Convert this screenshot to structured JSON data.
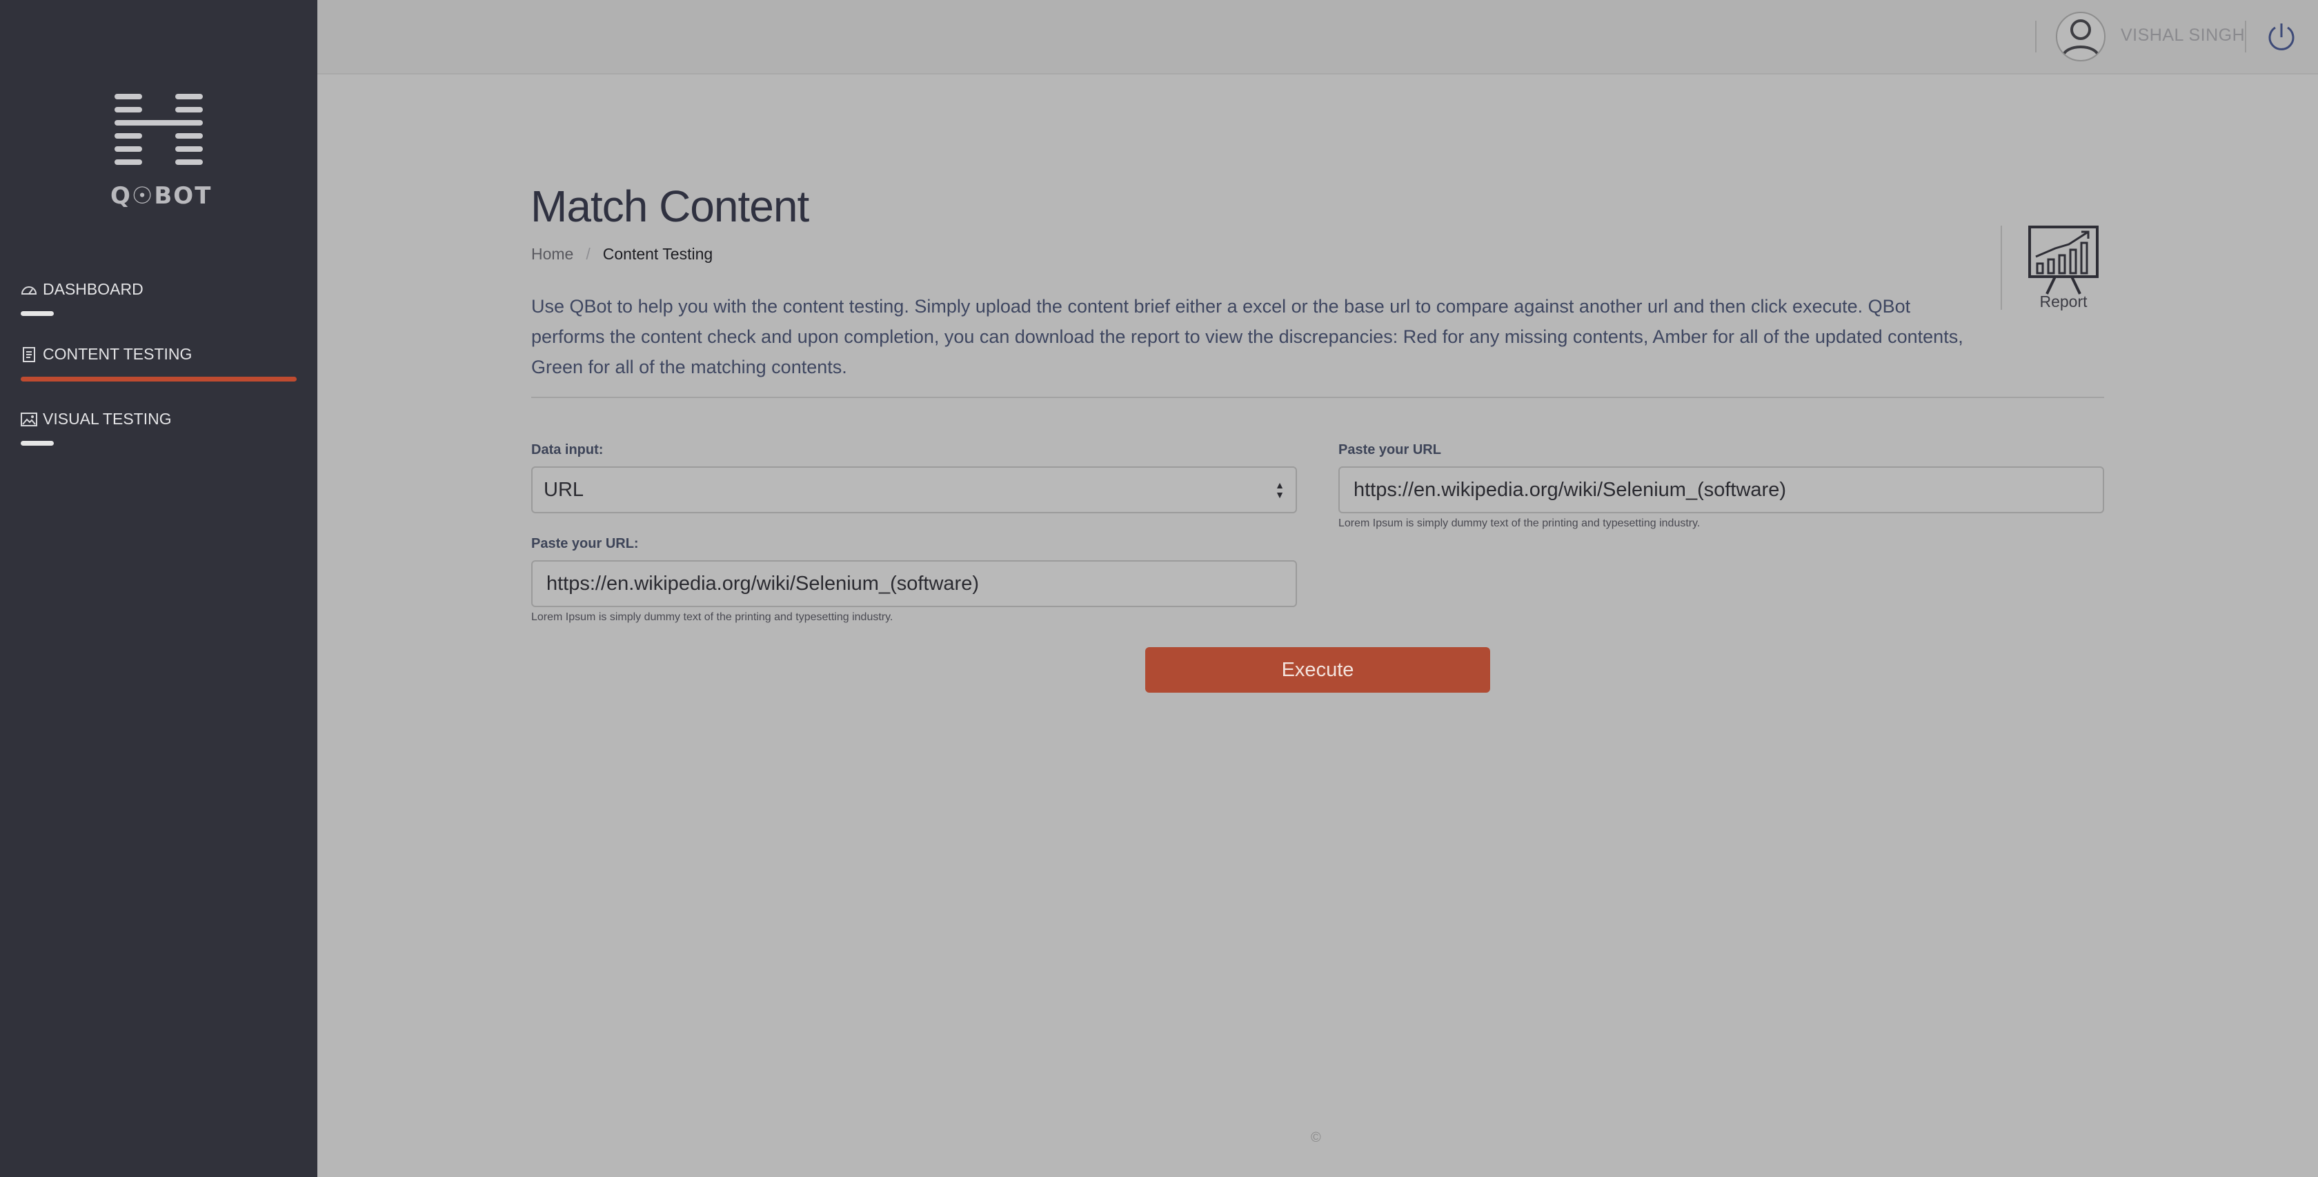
{
  "brand": {
    "logo_text": "Q☉BOT"
  },
  "sidebar": {
    "items": [
      {
        "label": "DASHBOARD",
        "icon": "gauge-icon",
        "active": false
      },
      {
        "label": "CONTENT TESTING",
        "icon": "document-icon",
        "active": true
      },
      {
        "label": "VISUAL TESTING",
        "icon": "image-icon",
        "active": false
      }
    ]
  },
  "header": {
    "username": "VISHAL SINGH",
    "avatar_icon": "user-icon",
    "logout_icon": "power-icon"
  },
  "page": {
    "title": "Match Content",
    "breadcrumb": {
      "home": "Home",
      "separator": "/",
      "current": "Content Testing"
    },
    "description": "Use QBot to help you with the content testing. Simply upload the content brief either a excel or the base url to compare against another url and then click execute.  QBot performs the content check and upon completion, you can download the report to view the discrepancies: Red for any missing contents, Amber for all of the updated contents, Green for all of the matching contents.",
    "report_label": "Report"
  },
  "form": {
    "data_input": {
      "label": "Data input:",
      "value": "URL"
    },
    "url_left": {
      "label": "Paste your URL:",
      "value": "https://en.wikipedia.org/wiki/Selenium_(software)",
      "help": "Lorem Ipsum is simply dummy text of the printing and typesetting industry."
    },
    "url_right": {
      "label": "Paste your URL",
      "value": "https://en.wikipedia.org/wiki/Selenium_(software)",
      "help": "Lorem Ipsum is simply dummy text of the printing and typesetting industry."
    },
    "execute_label": "Execute"
  },
  "footer": {
    "copyright": "©"
  },
  "colors": {
    "sidebar_bg": "#31323b",
    "page_bg": "#b7b7b7",
    "accent": "#b04b33",
    "active_underline": "#bf4b30"
  }
}
